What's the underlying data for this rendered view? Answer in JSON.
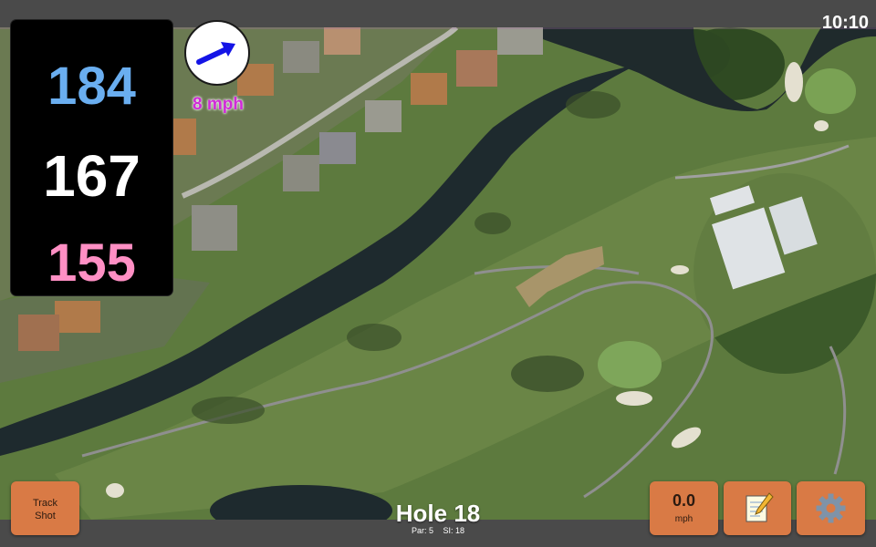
{
  "status": {
    "clock": "10:10"
  },
  "distances": {
    "back": "184",
    "middle": "167",
    "front": "155"
  },
  "wind": {
    "speed_label": "8 mph",
    "arrow_icon": "wind-direction-arrow-icon"
  },
  "hole": {
    "title": "Hole 18",
    "par_label": "Par: 5",
    "si_label": "SI: 18"
  },
  "buttons": {
    "track_shot_line1": "Track",
    "track_shot_line2": "Shot",
    "wind_value": "0.0",
    "wind_unit": "mph",
    "notes_icon": "notepad-icon",
    "settings_icon": "gear-icon"
  },
  "colors": {
    "back_distance": "#6aaef0",
    "middle_distance": "#ffffff",
    "front_distance": "#ff8fc4",
    "button_bg": "#d97a45",
    "wind_text": "#d02ad8"
  }
}
